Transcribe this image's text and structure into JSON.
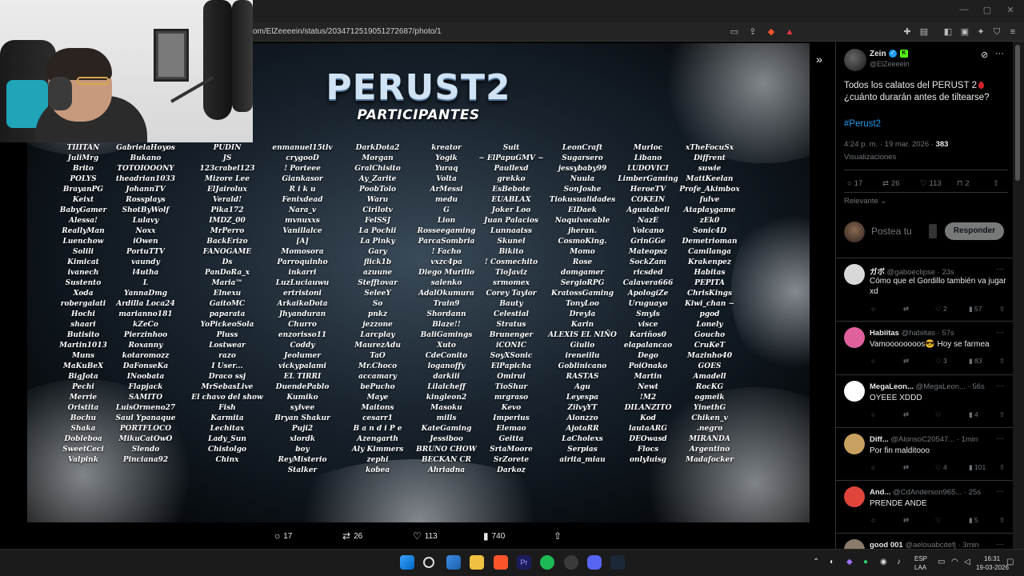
{
  "browser": {
    "url": "om/ElZeeeein/status/2034712519051272687/photo/1"
  },
  "photo": {
    "title": "PERUST2",
    "subtitle": "PARTICIPANTES",
    "columns": [
      [
        "TIIITAN",
        "JuliMrg",
        "Brito",
        "POLYS",
        "BrayanPG",
        "Keixt",
        "BabyGamer",
        "Alessa!",
        "ReallyMan",
        "Luenchow",
        "Solili",
        "Kimicat",
        "ivanech",
        "Sustento",
        "Xoda",
        "robergalati",
        "Hochi",
        "shaari",
        "Butisito",
        "Martin1013",
        "Muns",
        "MaKuBeX",
        "BigJota",
        "Pechi",
        "Merrie",
        "Oristita",
        "Bochu",
        "Shaka",
        "Dobleboa",
        "SweetCeci",
        "Valpink"
      ],
      [
        "GabrielaHoyos",
        "Bukano",
        "TOTOIOOONY",
        "theadrian1033",
        "JohannTV",
        "Rossplays",
        "ShotByWolf",
        "Lulavy",
        "Noxx",
        "iOwen",
        "PortuTTV",
        "vaundy",
        "l4utha",
        "L",
        "YannaDmg",
        "Ardilla Loca24",
        "marianno181",
        "kZeCo",
        "Pierzinhoo",
        "Roxanny",
        "kotaromozz",
        "DaFonseKa",
        "INoobata",
        "Flapjack",
        "SAMITO",
        "LuisOrmeno27",
        "Saul Ypanaque",
        "PORTFLOCO",
        "MikuCatOwO",
        "Slendo",
        "Pinciana92"
      ],
      [
        "PUDIN",
        "JS",
        "123crabel123",
        "Mizore Lee",
        "ElJairolux",
        "Verald!",
        "Pika172",
        "IMDZ_00",
        "MrPerro",
        "BackErizo",
        "FANOGAME",
        "Ds",
        "PanDoRa_x",
        "Maria™",
        "Elnexu",
        "GaitoMC",
        "paparata",
        "YoPickeoSola",
        "Pluss",
        "Lostwear",
        "razo",
        "I User...",
        "Draco ssj",
        "MrSebasLive",
        "El chavo del show",
        "Fish",
        "Karmita",
        "Lechitax",
        "Lady_Sun",
        "Chistolgo",
        "Chinx"
      ],
      [
        "enmanuel15tlv",
        "crygooD",
        "! Porteee",
        "Giankasor",
        "R i k u",
        "Fenixdead",
        "Nara_v",
        "mvnuxxs",
        "Vanillalce",
        "[A]",
        "Momosora",
        "Parroquinho",
        "inkarri",
        "LuzLuciauwu",
        "ertristoni",
        "ArkaikoDota",
        "Jhyanduran",
        "Churro",
        "enzorisso11",
        "Coddy",
        "Jeolumer",
        "vickypalami",
        "EL TIRRI",
        "DuendePablo",
        "Kumiko",
        "sylvee",
        "Bryan Shakur",
        "Puji2",
        "xlordk",
        "boy",
        "ReyMisterio",
        "Stalker"
      ],
      [
        "DarkDota2",
        "Morgan",
        "GralChisito",
        "Ay_Zarite",
        "PoobTolo",
        "Waru",
        "Cirilotv",
        "FelSSJ",
        "La Pochii",
        "La Pinky",
        "Gary",
        "flick1b",
        "azuune",
        "Stefftovar",
        "SeleeY",
        "So",
        "pnkz",
        "jezzone",
        "Larcplay",
        "MaurezAdu",
        "TaO",
        "Mr.Choco",
        "accamary",
        "bePucho",
        "Maye",
        "Maitons",
        "cesarr1",
        "B a n d i P e",
        "Azengarth",
        "Aly Kimmers",
        "zephi",
        "kobea"
      ],
      [
        "kreator",
        "Yogik",
        "Yuraq",
        "Volta",
        "ArMessi",
        "medu",
        "G",
        "Lion",
        "Rosseegaming",
        "ParcaSombria",
        "! Facho",
        "vxzc4pa",
        "Diego Murillo",
        "salenko",
        "AdalOkumura",
        "Train9",
        "Shordann",
        "Blaze!!",
        "BaliGamings",
        "Xuto",
        "CdeConito",
        "loganoffy",
        "darkiii",
        "Lilalcheff",
        "kingleon2",
        "Masoku",
        "mills",
        "KateGaming",
        "Jessiboo",
        "BRUNO CHOW",
        "BECKAN CR",
        "Ahriadna"
      ],
      [
        "Suit",
        "~ ElPapuGMV ~",
        "Paullexd",
        "grekko",
        "EsBebote",
        "EUABLAX",
        "Joker Loo",
        "Juan Palacios",
        "Lunnaatss",
        "Skunel",
        "Bikito",
        "! Cosmechito",
        "TioJaviz",
        "srmomex",
        "Corey Taylor",
        "Bauty",
        "Celestial",
        "Stratus",
        "Brunenger",
        "iCONIC",
        "SoyXSonic",
        "ElPapicha",
        "Omirui",
        "TioShur",
        "mrgraso",
        "Kevo",
        "Imperius",
        "Elemao",
        "Geitta",
        "SrtaMoore",
        "SrZorete",
        "Darkoz"
      ],
      [
        "LeonCraft",
        "Sugarsero",
        "jessybaby99",
        "Nuula",
        "SonJoshe",
        "Tiokusualidades",
        "ElDaek",
        "Noquivocable",
        "jheran.",
        "CosmoKing.",
        "Momo",
        "Rose",
        "domgamer",
        "SergioRPG",
        "KratossGaming",
        "TonyLoo",
        "Dreyla",
        "Karin",
        "ALEXIS EL NIÑO",
        "Giulio",
        "ireneiilu",
        "Goblinicano",
        "RASTAS",
        "Agu",
        "Leyespa",
        "ZilvyYT",
        "Alonzzo",
        "AjotaRR",
        "LaCholexs",
        "Serpias",
        "airita_miau"
      ],
      [
        "Murloc",
        "Libano",
        "LUDOVICI",
        "LimberGaming",
        "HeroeTV",
        "COKEIN",
        "Agustabell",
        "NazE",
        "Volcano",
        "GrinGGe",
        "Mateopsz",
        "SockZam",
        "ricsded",
        "Calavera666",
        "ApologiZe",
        "Uruguayo",
        "Smyls",
        "visce",
        "Kariños0",
        "elapalancao",
        "Dego",
        "PoiOnako",
        "Martin",
        "Newt",
        "!M2",
        "DILANZITO",
        "Kod",
        "lautaARG",
        "DEOwasd",
        "Flocs",
        "onlyluisg"
      ],
      [
        "xTheFocuSx",
        "Diffrent",
        "suwie",
        "MattKeelan",
        "Profe_Akimbox",
        "fulve",
        "Ataplaygame",
        "zEk0",
        "Sonic4D",
        "Demetrioman",
        "Camilanga",
        "Krakenpez",
        "Habitas",
        "PEPITA",
        "ChrisKings",
        "Kiwi_chan ~",
        "pgod",
        "Lonely",
        "Goucho",
        "CruKeT",
        "Mazinho40",
        "GOES",
        "Amadell",
        "RocKG",
        "ogmeik",
        "YinethG",
        "Chiken_v",
        ".negro",
        "MIRANDA",
        "Argentino",
        "Madafocker"
      ]
    ]
  },
  "viewer_stats": {
    "replies": "17",
    "reposts": "26",
    "likes": "113",
    "views": "740"
  },
  "tweet": {
    "author": "Zein",
    "handle": "@ElZeeeein",
    "text_line1": "Todos los calatos del PERUST 2",
    "text_line2": "¿cuánto durarán antes de tiltearse?",
    "hashtag": "#Perust2",
    "time": "4:24 p. m. · 19 mar. 2026 · ",
    "views_count": "383",
    "views_label": "Visualizaciones",
    "replies": "17",
    "reposts": "26",
    "likes": "113",
    "bookmarks": "2",
    "sort_label": "Relevante",
    "reply_placeholder": "Postea tu",
    "reply_button": "Responder"
  },
  "comments": [
    {
      "name": "ガボ",
      "handle": "@gaboeclipse · 23s",
      "text": "Cómo que el Gordillo también va jugar xd",
      "likes": "2",
      "views": "57",
      "avatar_color": "#d8d8d8"
    },
    {
      "name": "Habiitas",
      "handle": "@habiitas · 57s",
      "text": "Vamoooooooos😎 Hoy se farmea",
      "likes": "3",
      "views": "83",
      "avatar_color": "#e0609c"
    },
    {
      "name": "MegaLeon...",
      "handle": "@MegaLeon... · 56s",
      "text": "OYEEE XDDD",
      "likes": "",
      "views": "4",
      "avatar_color": "#ffffff"
    },
    {
      "name": "Diff...",
      "handle": "@AlonsoC20547... · 1min",
      "text": "Por fin malditooo",
      "likes": "4",
      "views": "101",
      "avatar_color": "#c8a060"
    },
    {
      "name": "And...",
      "handle": "@CdAnderson965... · 25s",
      "text": "PRENDE ANDE",
      "likes": "",
      "views": "5",
      "avatar_color": "#e0443a"
    },
    {
      "name": "good 001",
      "handle": "@aelouabcdefj · 3min",
      "text": "",
      "likes": "",
      "views": "",
      "avatar_color": "#8a7a6a"
    }
  ],
  "taskbar": {
    "lang1": "ESP",
    "lang2": "LAA",
    "time": "16:31",
    "date": "19-03-2026"
  },
  "colors": {
    "accent": "#1d9bf0",
    "background": "#000000",
    "muted": "#71767b"
  }
}
